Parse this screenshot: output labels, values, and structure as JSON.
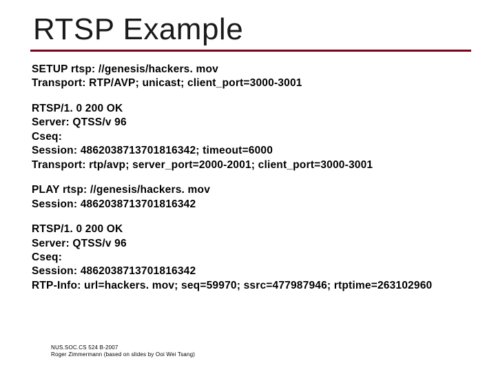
{
  "title": "RTSP Example",
  "blocks": {
    "b1": {
      "l1": "SETUP rtsp: //genesis/hackers. mov",
      "l2": "Transport: RTP/AVP; unicast; client_port=3000-3001"
    },
    "b2": {
      "l1": "RTSP/1. 0 200 OK",
      "l2": "Server: QTSS/v 96",
      "l3": "Cseq:",
      "l4": "Session: 4862038713701816342; timeout=6000",
      "l5": "Transport: rtp/avp; server_port=2000-2001; client_port=3000-3001"
    },
    "b3": {
      "l1": "PLAY rtsp: //genesis/hackers. mov",
      "l2": "Session: 4862038713701816342"
    },
    "b4": {
      "l1": "RTSP/1. 0 200 OK",
      "l2": "Server: QTSS/v 96",
      "l3": "Cseq:",
      "l4": "Session: 4862038713701816342",
      "l5": "RTP-Info: url=hackers. mov; seq=59970; ssrc=477987946; rtptime=263102960"
    }
  },
  "footer": {
    "l1": "NUS.SOC.CS 524 B-2007",
    "l2": "Roger Zimmermann (based on slides by Ooi Wei Tsang)"
  }
}
